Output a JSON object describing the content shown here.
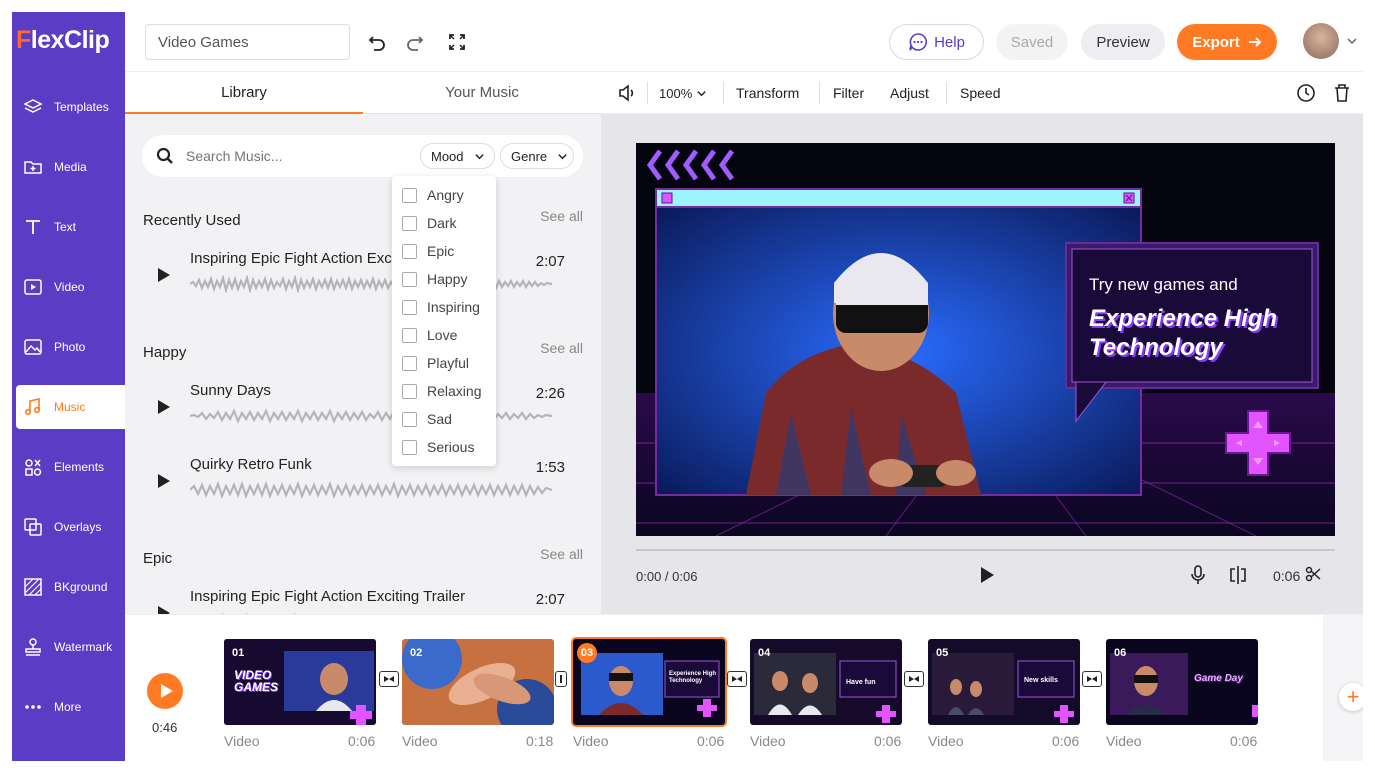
{
  "app": {
    "logo_first": "F",
    "logo_rest": "lexClip"
  },
  "sidebar": {
    "items": [
      {
        "label": "Templates",
        "icon": "layers-icon"
      },
      {
        "label": "Media",
        "icon": "folder-plus-icon"
      },
      {
        "label": "Text",
        "icon": "text-icon"
      },
      {
        "label": "Video",
        "icon": "video-icon"
      },
      {
        "label": "Photo",
        "icon": "photo-icon"
      },
      {
        "label": "Music",
        "icon": "music-icon",
        "active": true
      },
      {
        "label": "Elements",
        "icon": "elements-icon"
      },
      {
        "label": "Overlays",
        "icon": "overlays-icon"
      },
      {
        "label": "BKground",
        "icon": "background-icon"
      },
      {
        "label": "Watermark",
        "icon": "stamp-icon"
      },
      {
        "label": "More",
        "icon": "more-icon"
      }
    ]
  },
  "topbar": {
    "project_name": "Video Games",
    "help": "Help",
    "saved": "Saved",
    "preview": "Preview",
    "export": "Export"
  },
  "music": {
    "tabs": {
      "library": "Library",
      "your_music": "Your Music"
    },
    "search_placeholder": "Search Music...",
    "mood_label": "Mood",
    "genre_label": "Genre",
    "see_all": "See all",
    "sections": [
      {
        "title": "Recently Used",
        "tracks": [
          {
            "title": "Inspiring Epic Fight Action Exciting Trailer",
            "duration": "2:07"
          }
        ]
      },
      {
        "title": "Happy",
        "tracks": [
          {
            "title": "Sunny Days",
            "duration": "2:26"
          },
          {
            "title": "Quirky Retro Funk",
            "duration": "1:53"
          }
        ]
      },
      {
        "title": "Epic",
        "tracks": [
          {
            "title": "Inspiring Epic Fight Action Exciting Trailer",
            "duration": "2:07"
          }
        ]
      }
    ],
    "moods": [
      "Angry",
      "Dark",
      "Epic",
      "Happy",
      "Inspiring",
      "Love",
      "Playful",
      "Relaxing",
      "Sad",
      "Serious"
    ]
  },
  "editor": {
    "zoom": "100%",
    "tools": [
      "Transform",
      "Filter",
      "Adjust",
      "Speed"
    ],
    "stage": {
      "line1": "Try new games and",
      "line2": "Experience High",
      "line3": "Technology"
    },
    "time_readout": "0:00 / 0:06",
    "clip_time": "0:06"
  },
  "timeline": {
    "total_time": "0:46",
    "clips": [
      {
        "num": "01",
        "label": "Video",
        "duration": "0:06",
        "headline": "VIDEO GAMES"
      },
      {
        "num": "02",
        "label": "Video",
        "duration": "0:18",
        "headline": ""
      },
      {
        "num": "03",
        "label": "Video",
        "duration": "0:06",
        "headline": "Experience High Technology"
      },
      {
        "num": "04",
        "label": "Video",
        "duration": "0:06",
        "headline": "Have fun"
      },
      {
        "num": "05",
        "label": "Video",
        "duration": "0:06",
        "headline": "New skills"
      },
      {
        "num": "06",
        "label": "Video",
        "duration": "0:06",
        "headline": "Game Day"
      }
    ]
  },
  "colors": {
    "brand_purple": "#5b3cc4",
    "accent_orange": "#ff7a22",
    "neon_pink": "#e254ff",
    "neon_cyan": "#9cf4ff"
  }
}
